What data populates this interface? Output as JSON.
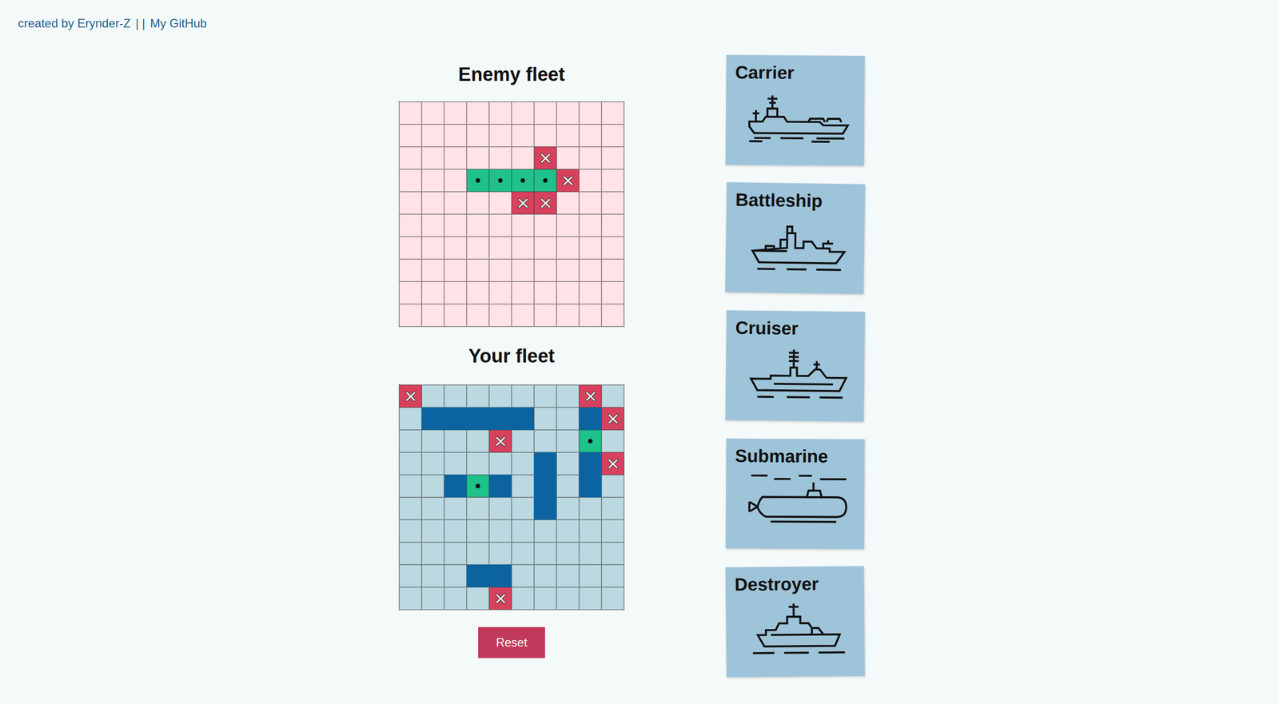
{
  "header": {
    "credit": "created by Erynder-Z",
    "separator": "| |",
    "link": "My GitHub"
  },
  "boards": [
    {
      "title": "Enemy fleet",
      "kind": "enemy",
      "cells": [
        [
          "water",
          "water",
          "water",
          "water",
          "water",
          "water",
          "water",
          "water",
          "water",
          "water"
        ],
        [
          "water",
          "water",
          "water",
          "water",
          "water",
          "water",
          "water",
          "water",
          "water",
          "water"
        ],
        [
          "water",
          "water",
          "water",
          "water",
          "water",
          "water",
          "miss",
          "water",
          "water",
          "water"
        ],
        [
          "water",
          "water",
          "water",
          "hit",
          "hit",
          "hit",
          "hit",
          "miss",
          "water",
          "water"
        ],
        [
          "water",
          "water",
          "water",
          "water",
          "water",
          "miss",
          "miss",
          "water",
          "water",
          "water"
        ],
        [
          "water",
          "water",
          "water",
          "water",
          "water",
          "water",
          "water",
          "water",
          "water",
          "water"
        ],
        [
          "water",
          "water",
          "water",
          "water",
          "water",
          "water",
          "water",
          "water",
          "water",
          "water"
        ],
        [
          "water",
          "water",
          "water",
          "water",
          "water",
          "water",
          "water",
          "water",
          "water",
          "water"
        ],
        [
          "water",
          "water",
          "water",
          "water",
          "water",
          "water",
          "water",
          "water",
          "water",
          "water"
        ],
        [
          "water",
          "water",
          "water",
          "water",
          "water",
          "water",
          "water",
          "water",
          "water",
          "water"
        ]
      ]
    },
    {
      "title": "Your fleet",
      "kind": "player",
      "cells": [
        [
          "miss",
          "water",
          "water",
          "water",
          "water",
          "water",
          "water",
          "water",
          "miss",
          "water"
        ],
        [
          "water",
          "ship",
          "ship",
          "ship",
          "ship",
          "ship",
          "water",
          "water",
          "ship",
          "miss"
        ],
        [
          "water",
          "water",
          "water",
          "water",
          "miss",
          "water",
          "water",
          "water",
          "hit",
          "water"
        ],
        [
          "water",
          "water",
          "water",
          "water",
          "water",
          "water",
          "ship",
          "water",
          "ship",
          "miss"
        ],
        [
          "water",
          "water",
          "ship",
          "hit",
          "ship",
          "water",
          "ship",
          "water",
          "ship",
          "water"
        ],
        [
          "water",
          "water",
          "water",
          "water",
          "water",
          "water",
          "ship",
          "water",
          "water",
          "water"
        ],
        [
          "water",
          "water",
          "water",
          "water",
          "water",
          "water",
          "water",
          "water",
          "water",
          "water"
        ],
        [
          "water",
          "water",
          "water",
          "water",
          "water",
          "water",
          "water",
          "water",
          "water",
          "water"
        ],
        [
          "water",
          "water",
          "water",
          "ship",
          "ship",
          "water",
          "water",
          "water",
          "water",
          "water"
        ],
        [
          "water",
          "water",
          "water",
          "water",
          "miss",
          "water",
          "water",
          "water",
          "water",
          "water"
        ]
      ]
    }
  ],
  "reset_button": "Reset",
  "ships": [
    {
      "name": "Carrier"
    },
    {
      "name": "Battleship"
    },
    {
      "name": "Cruiser"
    },
    {
      "name": "Submarine"
    },
    {
      "name": "Destroyer"
    }
  ]
}
